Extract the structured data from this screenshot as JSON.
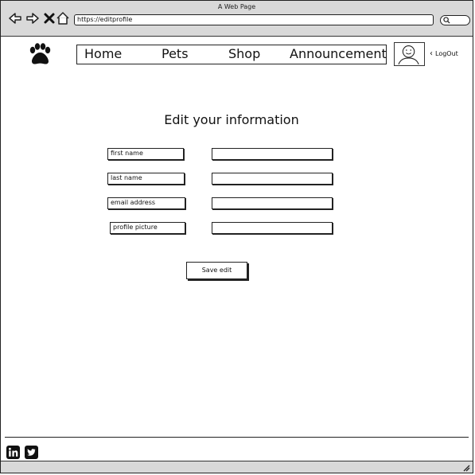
{
  "window": {
    "title": "A Web Page"
  },
  "browser": {
    "url": "https://editprofile"
  },
  "header": {
    "nav": [
      "Home",
      "Pets",
      "Shop",
      "Announcement"
    ],
    "logout": "LogOut"
  },
  "form": {
    "title": "Edit your information",
    "fields": [
      {
        "label": "first name",
        "value": ""
      },
      {
        "label": "last name",
        "value": ""
      },
      {
        "label": "email address",
        "value": ""
      },
      {
        "label": "profile picture",
        "value": ""
      }
    ],
    "save_label": "Save edit"
  },
  "icons": {
    "logo": "paw-icon",
    "social": [
      "linkedin-icon",
      "twitter-icon"
    ]
  }
}
